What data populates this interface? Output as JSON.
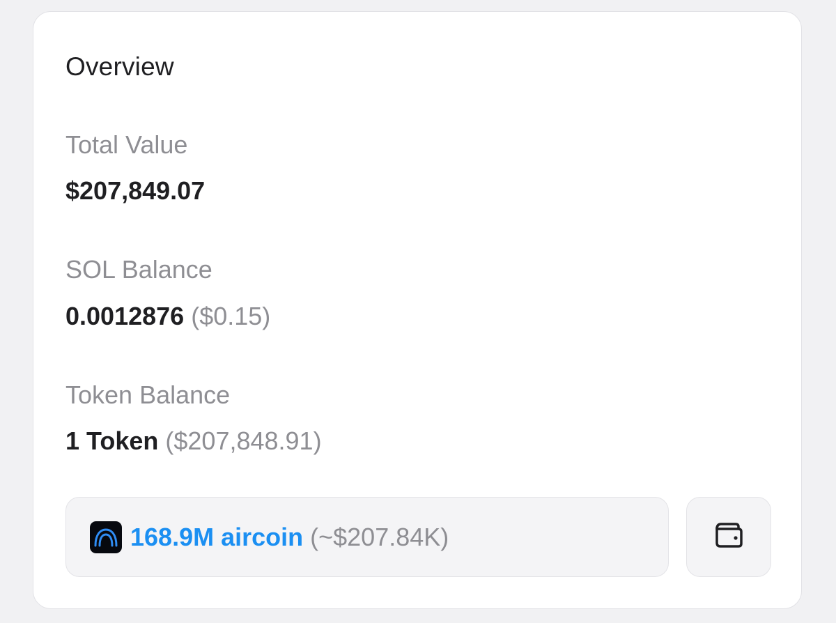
{
  "overview": {
    "title": "Overview",
    "total_value": {
      "label": "Total Value",
      "value": "$207,849.07"
    },
    "sol_balance": {
      "label": "SOL Balance",
      "amount": "0.0012876",
      "usd": "($0.15)"
    },
    "token_balance": {
      "label": "Token Balance",
      "amount": "1 Token",
      "usd": "($207,848.91)"
    },
    "token_item": {
      "icon": "aircoin-logo-icon",
      "amount": "168.9M aircoin",
      "usd": "(~$207.84K)"
    },
    "wallet_button": {
      "icon": "wallet-icon"
    }
  },
  "colors": {
    "accent": "#1b8ff2",
    "muted": "#8e8e93",
    "text": "#1f1f22"
  }
}
